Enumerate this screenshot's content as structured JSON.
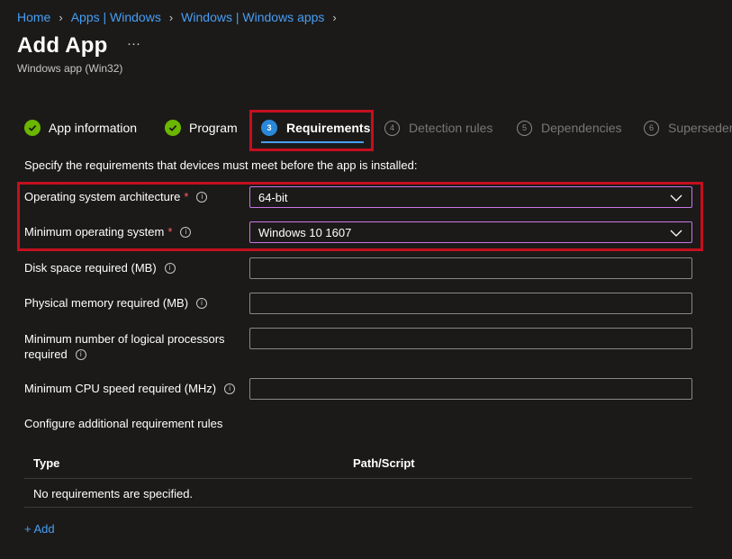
{
  "breadcrumb": [
    "Home",
    "Apps | Windows",
    "Windows | Windows apps"
  ],
  "page": {
    "title": "Add App",
    "more": "···",
    "subtitle": "Windows app (Win32)"
  },
  "steps": [
    {
      "label": "App information",
      "state": "done"
    },
    {
      "label": "Program",
      "state": "done"
    },
    {
      "number": "3",
      "label": "Requirements",
      "state": "current"
    },
    {
      "number": "4",
      "label": "Detection rules",
      "state": "disabled"
    },
    {
      "number": "5",
      "label": "Dependencies",
      "state": "disabled"
    },
    {
      "number": "6",
      "label": "Supersedence",
      "state": "disabled"
    }
  ],
  "form": {
    "intro": "Specify the requirements that devices must meet before the app is installed:",
    "os_arch": {
      "label": "Operating system architecture",
      "required": "*",
      "value": "64-bit"
    },
    "min_os": {
      "label": "Minimum operating system",
      "required": "*",
      "value": "Windows 10 1607"
    },
    "disk_space": {
      "label": "Disk space required (MB)",
      "value": ""
    },
    "memory": {
      "label": "Physical memory required (MB)",
      "value": ""
    },
    "processors": {
      "label_line1": "Minimum number of logical processors",
      "label_line2": "required",
      "value": ""
    },
    "cpu_speed": {
      "label": "Minimum CPU speed required (MHz)",
      "value": ""
    }
  },
  "rules": {
    "heading": "Configure additional requirement rules",
    "columns": [
      "Type",
      "Path/Script"
    ],
    "empty": "No requirements are specified.",
    "add_label": "+ Add"
  },
  "icons": {
    "info": "info-icon",
    "chevron": "chevron-down-icon",
    "check": "checkmark-icon",
    "separator": "chevron-right-icon"
  },
  "colors": {
    "accent": "#479ef5",
    "success": "#6bb700",
    "highlight": "#c50f1f",
    "focus_border": "#c776e6",
    "required": "#ff5f5f"
  }
}
